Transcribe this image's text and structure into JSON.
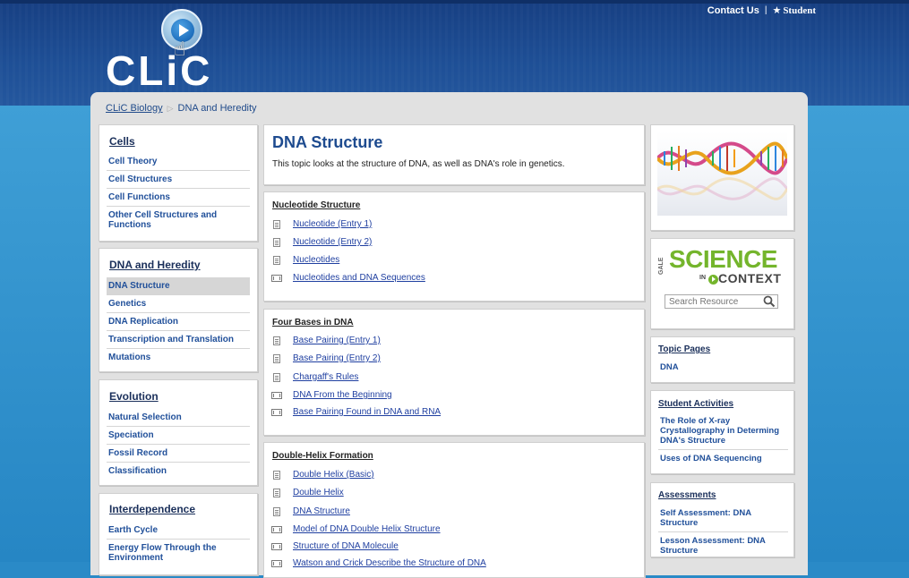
{
  "header": {
    "contact_us": "Contact Us",
    "separator": "|",
    "student_label": "Student",
    "logo_text": "CLiC"
  },
  "breadcrumb": {
    "root": "CLiC Biology",
    "current": "DNA and Heredity"
  },
  "sidebar": {
    "sections": [
      {
        "title": "Cells",
        "items": [
          "Cell Theory",
          "Cell Structures",
          "Cell Functions",
          "Other Cell Structures and Functions"
        ]
      },
      {
        "title": "DNA and Heredity",
        "items": [
          "DNA Structure",
          "Genetics",
          "DNA Replication",
          "Transcription and Translation",
          "Mutations"
        ],
        "active_index": 0
      },
      {
        "title": "Evolution",
        "items": [
          "Natural Selection",
          "Speciation",
          "Fossil Record",
          "Classification"
        ]
      },
      {
        "title": "Interdependence",
        "items": [
          "Earth Cycle",
          "Energy Flow Through the Environment"
        ]
      }
    ]
  },
  "main": {
    "title": "DNA Structure",
    "description": "This topic looks at the structure of DNA, as well as DNA's role in genetics.",
    "sections": [
      {
        "title": "Nucleotide Structure",
        "resources": [
          {
            "type": "document-icon",
            "label": "Nucleotide (Entry 1)"
          },
          {
            "type": "document-icon",
            "label": "Nucleotide (Entry 2)"
          },
          {
            "type": "document-icon",
            "label": "Nucleotides"
          },
          {
            "type": "video-icon",
            "label": "Nucleotides and DNA Sequences"
          }
        ]
      },
      {
        "title": "Four Bases in DNA",
        "resources": [
          {
            "type": "document-icon",
            "label": "Base Pairing (Entry 1)"
          },
          {
            "type": "document-icon",
            "label": "Base Pairing (Entry 2)"
          },
          {
            "type": "document-icon",
            "label": "Chargaff's Rules"
          },
          {
            "type": "video-icon",
            "label": "DNA From the Beginning"
          },
          {
            "type": "video-icon",
            "label": "Base Pairing Found in DNA and RNA"
          }
        ]
      },
      {
        "title": "Double-Helix Formation",
        "resources": [
          {
            "type": "document-icon",
            "label": "Double Helix (Basic)"
          },
          {
            "type": "document-icon",
            "label": "Double Helix"
          },
          {
            "type": "document-icon",
            "label": "DNA Structure"
          },
          {
            "type": "video-icon",
            "label": "Model of DNA Double Helix Structure"
          },
          {
            "type": "video-icon",
            "label": "Structure of DNA Molecule"
          },
          {
            "type": "video-icon",
            "label": "Watson and Crick Describe the Structure of DNA"
          }
        ]
      }
    ]
  },
  "right": {
    "gic": {
      "gale": "GALE",
      "science": "SCIENCE",
      "in": "IN",
      "context": "CONTEXT",
      "search_placeholder": "Search Resource"
    },
    "topic_pages": {
      "title": "Topic Pages",
      "items": [
        "DNA"
      ]
    },
    "student_activities": {
      "title": "Student Activities",
      "items": [
        "The Role of X-ray Crystallography in Determing DNA's Structure",
        "Uses of DNA Sequencing"
      ]
    },
    "assessments": {
      "title": "Assessments",
      "items": [
        "Self Assessment: DNA Structure",
        "Lesson Assessment: DNA Structure"
      ]
    }
  },
  "colors": {
    "accent": "#1e4b8f",
    "link": "#1f3fa0",
    "panel": "#e1e1e1",
    "header": "#1e4f96",
    "gic_green": "#74b52c"
  }
}
